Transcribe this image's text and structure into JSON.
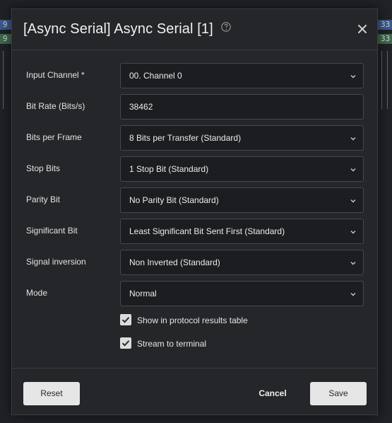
{
  "background": {
    "chips_left": [
      "9",
      "9"
    ],
    "chips_right": [
      "33",
      "33"
    ]
  },
  "dialog": {
    "title": "[Async Serial] Async Serial [1]",
    "help_icon": "question-circle-icon",
    "close_icon": "close-x-icon"
  },
  "fields": [
    {
      "label": "Input Channel *",
      "value": "00.  Channel 0",
      "dropdown": true
    },
    {
      "label": "Bit Rate (Bits/s)",
      "value": "38462",
      "dropdown": false
    },
    {
      "label": "Bits per Frame",
      "value": "8 Bits per Transfer (Standard)",
      "dropdown": true
    },
    {
      "label": "Stop Bits",
      "value": "1 Stop Bit (Standard)",
      "dropdown": true
    },
    {
      "label": "Parity Bit",
      "value": "No Parity Bit (Standard)",
      "dropdown": true
    },
    {
      "label": "Significant Bit",
      "value": "Least Significant Bit Sent First (Standard)",
      "dropdown": true
    },
    {
      "label": "Signal inversion",
      "value": "Non Inverted (Standard)",
      "dropdown": true
    },
    {
      "label": "Mode",
      "value": "Normal",
      "dropdown": true
    }
  ],
  "checkboxes": [
    {
      "label": "Show in protocol results table",
      "checked": true
    },
    {
      "label": "Stream to terminal",
      "checked": true
    }
  ],
  "footer": {
    "reset_label": "Reset",
    "cancel_label": "Cancel",
    "save_label": "Save"
  },
  "colors": {
    "dialog_bg": "#252629",
    "field_bg": "#1c1d20",
    "button_bg": "#e6e6e6",
    "chip_blue": "#3d5a8a",
    "chip_green": "#3f6a4a"
  }
}
